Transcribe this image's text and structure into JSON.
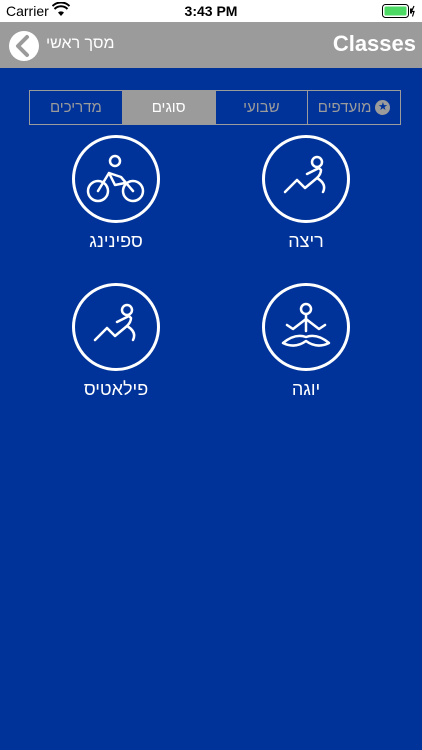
{
  "status": {
    "carrier": "Carrier",
    "time": "3:43 PM"
  },
  "nav": {
    "back_label": "מסך ראשי",
    "title": "Classes"
  },
  "tabs": [
    {
      "label": "מדריכים",
      "active": false
    },
    {
      "label": "סוגים",
      "active": true
    },
    {
      "label": "שבועי",
      "active": false
    },
    {
      "label": "מועדפים",
      "active": false,
      "icon": "star-icon"
    }
  ],
  "classes": [
    {
      "label": "ריצה",
      "icon": "running-icon"
    },
    {
      "label": "ספינינג",
      "icon": "cycling-icon"
    },
    {
      "label": "יוגה",
      "icon": "yoga-icon"
    },
    {
      "label": "פילאטיס",
      "icon": "pilates-icon"
    }
  ],
  "colors": {
    "background": "#003399",
    "nav": "#9b9b9b",
    "active_tab": "#9b9b9b"
  }
}
